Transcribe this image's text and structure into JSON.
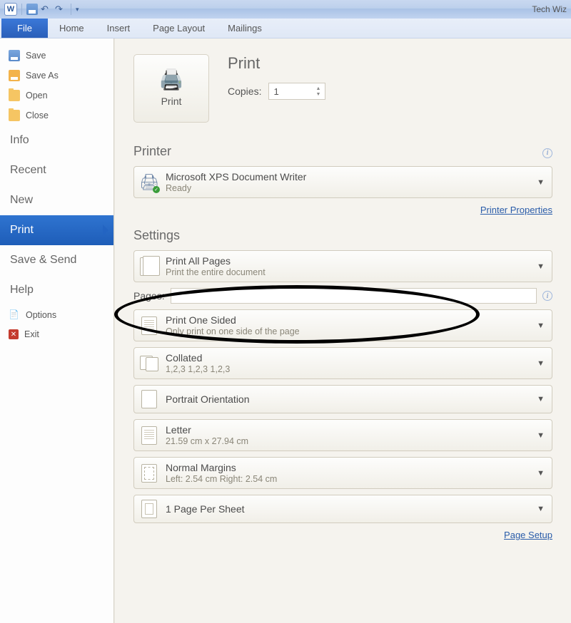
{
  "window": {
    "title": "Tech Wiz"
  },
  "qat": {
    "undo_tip": "Undo",
    "redo_tip": "Redo"
  },
  "ribbon_tabs": {
    "file": "File",
    "home": "Home",
    "insert": "Insert",
    "page_layout": "Page Layout",
    "mailings": "Mailings"
  },
  "nav": {
    "save": "Save",
    "save_as": "Save As",
    "open": "Open",
    "close": "Close",
    "info": "Info",
    "recent": "Recent",
    "new": "New",
    "print": "Print",
    "save_send": "Save & Send",
    "help": "Help",
    "options": "Options",
    "exit": "Exit"
  },
  "print_panel": {
    "print_button": "Print",
    "headline": "Print",
    "copies_label": "Copies:",
    "copies_value": "1",
    "printer_heading": "Printer",
    "printer_name": "Microsoft XPS Document Writer",
    "printer_status": "Ready",
    "printer_properties": "Printer Properties",
    "settings_heading": "Settings",
    "pages_label": "Pages:",
    "pages_value": "",
    "page_setup": "Page Setup",
    "selectors": {
      "scope": {
        "title": "Print All Pages",
        "sub": "Print the entire document"
      },
      "duplex": {
        "title": "Print One Sided",
        "sub": "Only print on one side of the page"
      },
      "collate": {
        "title": "Collated",
        "sub": "1,2,3    1,2,3    1,2,3"
      },
      "orient": {
        "title": "Portrait Orientation",
        "sub": ""
      },
      "paper": {
        "title": "Letter",
        "sub": "21.59 cm x 27.94 cm"
      },
      "margins": {
        "title": "Normal Margins",
        "sub": "Left:  2.54 cm    Right:  2.54 cm"
      },
      "sheets": {
        "title": "1 Page Per Sheet",
        "sub": ""
      }
    }
  }
}
